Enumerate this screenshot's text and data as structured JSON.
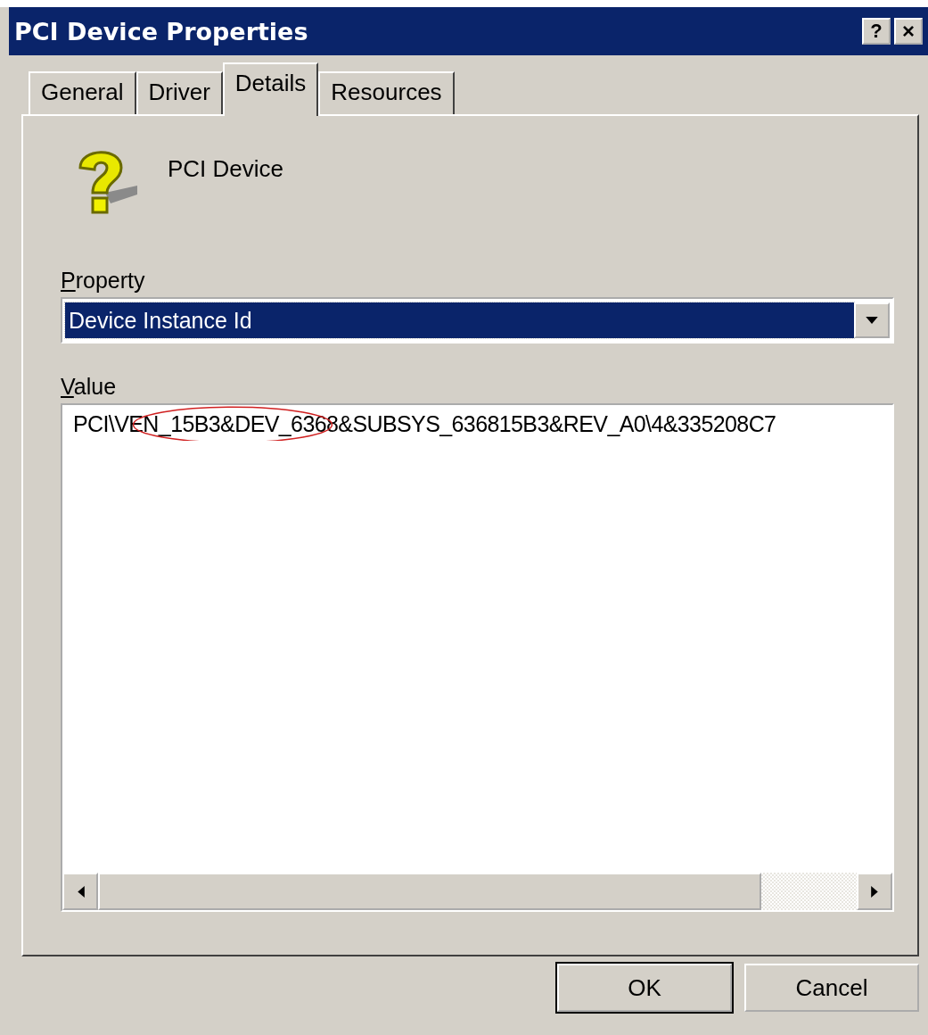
{
  "window": {
    "title": "PCI Device Properties",
    "title_buttons": [
      {
        "kind": "help",
        "label": "?"
      },
      {
        "kind": "close",
        "label": "×"
      }
    ]
  },
  "tabs": [
    {
      "label": "General",
      "selected": false
    },
    {
      "label": "Driver",
      "selected": false
    },
    {
      "label": "Details",
      "selected": true
    },
    {
      "label": "Resources",
      "selected": false
    }
  ],
  "device": {
    "name": "PCI Device"
  },
  "property": {
    "label": "Property",
    "value": "Device Instance Id"
  },
  "value": {
    "label": "Value",
    "text": "PCI\\VEN_15B3&DEV_6368&SUBSYS_636815B3&REV_A0\\4&335208C7"
  },
  "buttons": [
    {
      "label": "OK",
      "kind": "default"
    },
    {
      "label": "Cancel",
      "kind": "normal"
    }
  ]
}
